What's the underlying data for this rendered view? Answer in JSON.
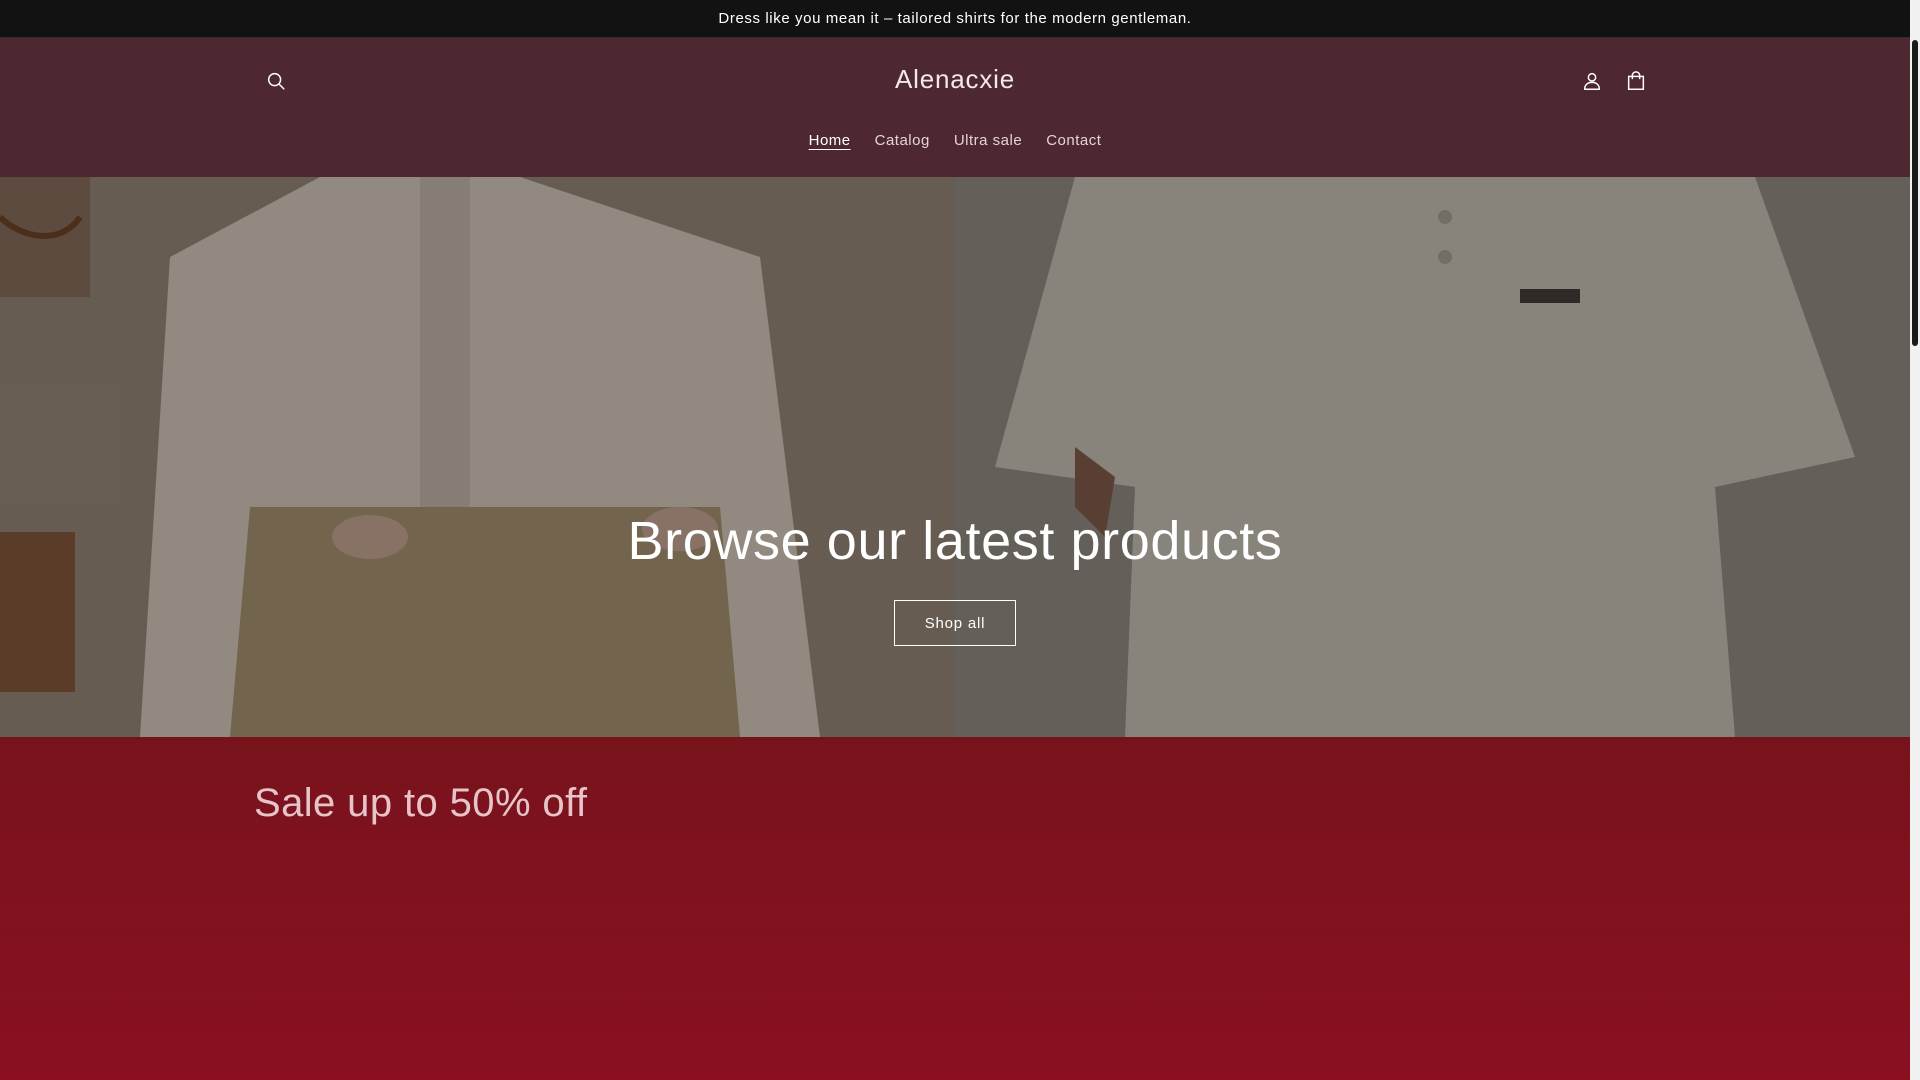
{
  "announcement": {
    "text": "Dress like you mean it – tailored shirts for the modern gentleman."
  },
  "header": {
    "logo": "Alenacxie",
    "icons": {
      "search": "search-icon",
      "account": "account-icon",
      "cart": "cart-icon"
    }
  },
  "nav": {
    "items": [
      {
        "label": "Home",
        "active": true
      },
      {
        "label": "Catalog",
        "active": false
      },
      {
        "label": "Ultra sale",
        "active": false
      },
      {
        "label": "Contact",
        "active": false
      }
    ]
  },
  "hero": {
    "heading": "Browse our latest products",
    "button_label": "Shop all"
  },
  "sale": {
    "heading": "Sale up to 50% off"
  },
  "colors": {
    "announcement_bg": "#121212",
    "header_bg": "#4e2830",
    "sale_bg": "#7f1320",
    "text_light": "#ffffff"
  }
}
